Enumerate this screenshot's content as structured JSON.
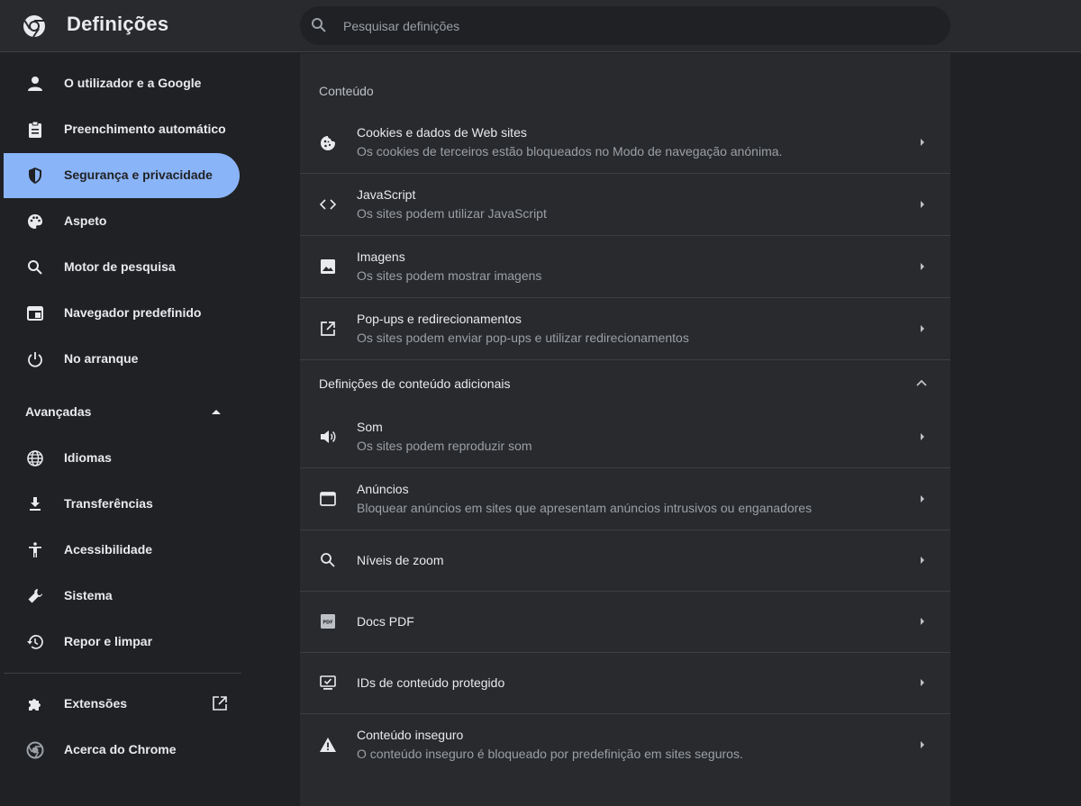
{
  "header": {
    "title": "Definições",
    "search_placeholder": "Pesquisar definições"
  },
  "sidebar": {
    "items": [
      {
        "label": "O utilizador e a Google",
        "icon": "person-icon"
      },
      {
        "label": "Preenchimento automático",
        "icon": "clipboard-icon"
      },
      {
        "label": "Segurança e privacidade",
        "icon": "shield-icon",
        "active": true
      },
      {
        "label": "Aspeto",
        "icon": "palette-icon"
      },
      {
        "label": "Motor de pesquisa",
        "icon": "search-icon"
      },
      {
        "label": "Navegador predefinido",
        "icon": "browser-icon"
      },
      {
        "label": "No arranque",
        "icon": "power-icon"
      }
    ],
    "advanced_label": "Avançadas",
    "advanced_items": [
      {
        "label": "Idiomas",
        "icon": "globe-icon"
      },
      {
        "label": "Transferências",
        "icon": "download-icon"
      },
      {
        "label": "Acessibilidade",
        "icon": "accessibility-icon"
      },
      {
        "label": "Sistema",
        "icon": "wrench-icon"
      },
      {
        "label": "Repor e limpar",
        "icon": "restore-icon"
      }
    ],
    "extensions_label": "Extensões",
    "about_label": "Acerca do Chrome"
  },
  "main": {
    "section_content": "Conteúdo",
    "rows": [
      {
        "title": "Cookies e dados de Web sites",
        "subtitle": "Os cookies de terceiros estão bloqueados no Modo de navegação anónima.",
        "icon": "cookie-icon"
      },
      {
        "title": "JavaScript",
        "subtitle": "Os sites podem utilizar JavaScript",
        "icon": "code-icon"
      },
      {
        "title": "Imagens",
        "subtitle": "Os sites podem mostrar imagens",
        "icon": "image-icon"
      },
      {
        "title": "Pop-ups e redirecionamentos",
        "subtitle": "Os sites podem enviar pop-ups e utilizar redirecionamentos",
        "icon": "open-external-icon"
      }
    ],
    "section_additional": "Definições de conteúdo adicionais",
    "additional_rows": [
      {
        "title": "Som",
        "subtitle": "Os sites podem reproduzir som",
        "icon": "speaker-icon"
      },
      {
        "title": "Anúncios",
        "subtitle": "Bloquear anúncios em sites que apresentam anúncios intrusivos ou enganadores",
        "icon": "ads-icon"
      },
      {
        "title": "Níveis de zoom",
        "subtitle": "",
        "icon": "zoom-icon"
      },
      {
        "title": "Docs PDF",
        "subtitle": "",
        "icon": "pdf-icon"
      },
      {
        "title": "IDs de conteúdo protegido",
        "subtitle": "",
        "icon": "protected-content-icon"
      },
      {
        "title": "Conteúdo inseguro",
        "subtitle": "O conteúdo inseguro é bloqueado por predefinição em sites seguros.",
        "icon": "warning-icon"
      }
    ]
  },
  "colors": {
    "accent": "#8ab4f8",
    "background": "#202124",
    "surface": "#292a2d"
  }
}
